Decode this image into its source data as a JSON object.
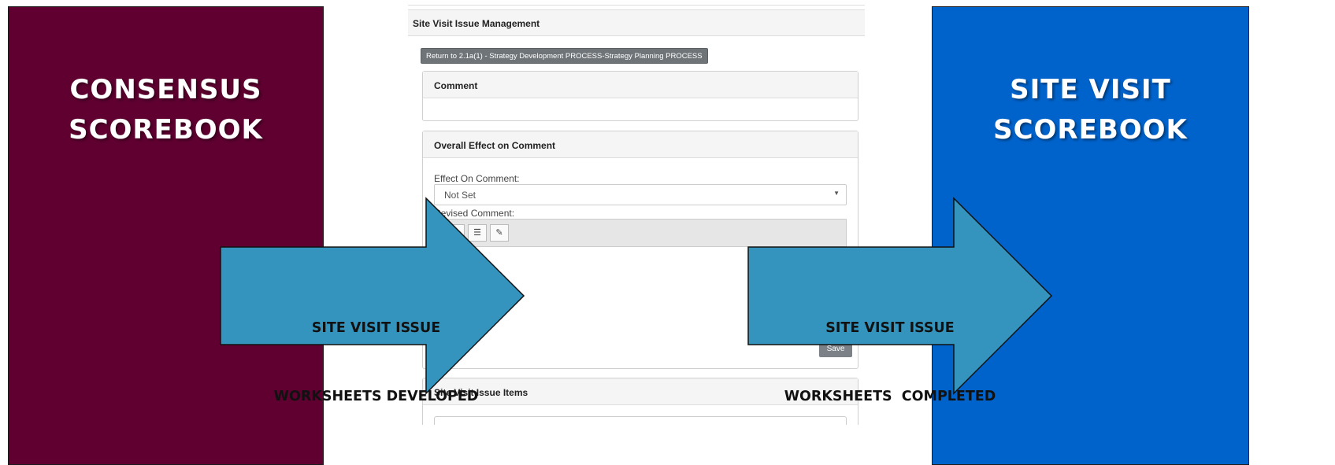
{
  "left_panel": {
    "title_line1": "CONSENSUS",
    "title_line2": "SCOREBOOK",
    "color": "#5f0030"
  },
  "right_panel": {
    "title_line1": "SITE VISIT",
    "title_line2": "SCOREBOOK",
    "color": "#0063cc"
  },
  "arrow_left": {
    "line1": "SITE VISIT ISSUE",
    "line2": "WORKSHEETS DEVELOPED",
    "color": "#3494bd"
  },
  "arrow_right": {
    "line1": "SITE VISIT ISSUE",
    "line2": "WORKSHEETS  COMPLETED",
    "color": "#3494bd"
  },
  "screen": {
    "header": "Site Visit Issue Management",
    "return_button": "Return to 2.1a(1) - Strategy Development PROCESS-Strategy Planning PROCESS",
    "comment_card": {
      "title": "Comment"
    },
    "effect_card": {
      "title": "Overall Effect on Comment",
      "effect_label": "Effect On Comment:",
      "effect_value": "Not Set",
      "revised_label": "Revised Comment:",
      "toolbar_icons": [
        "ordered-list-icon",
        "unordered-list-icon",
        "eraser-icon"
      ]
    },
    "save_label": "Save",
    "items_card": {
      "title": "Site Visit Issue Items"
    }
  }
}
